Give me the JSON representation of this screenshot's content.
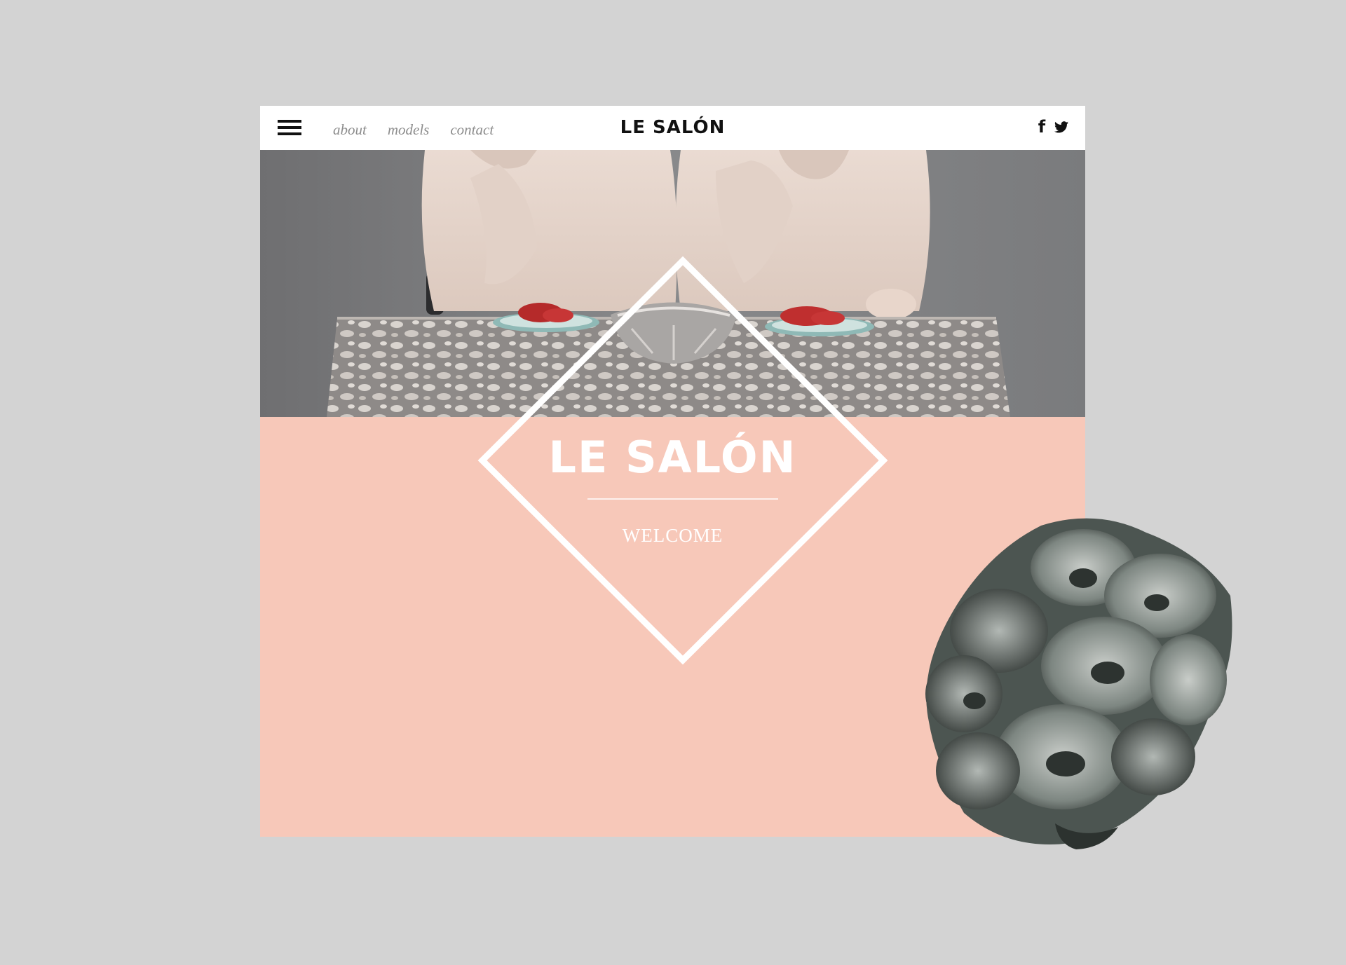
{
  "header": {
    "menu_icon": "hamburger-menu-icon",
    "nav": [
      {
        "label": "about"
      },
      {
        "label": "models"
      },
      {
        "label": "contact"
      }
    ],
    "logo": "LE SALÓN",
    "social": [
      {
        "icon": "facebook-icon",
        "glyph": "f"
      },
      {
        "icon": "twitter-icon"
      }
    ]
  },
  "hero": {
    "title": "LE SALÓN",
    "subtitle": "WELCOME"
  },
  "colors": {
    "background": "#d3d3d3",
    "accent_pink": "#f7c8b9",
    "header_bg": "#ffffff",
    "text_dark": "#111111",
    "nav_text": "#8c8c8c"
  }
}
